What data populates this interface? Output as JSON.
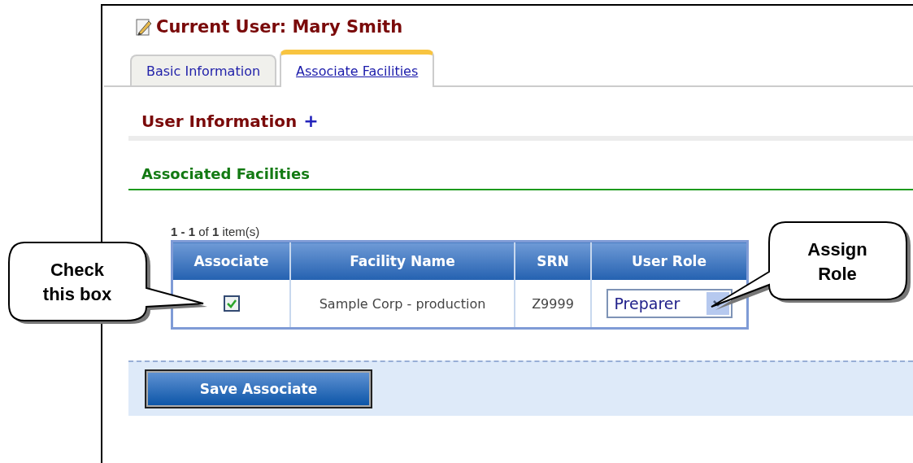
{
  "header": {
    "title": "Current User: Mary Smith"
  },
  "tabs": [
    {
      "label": "Basic Information",
      "selected": false
    },
    {
      "label": "Associate Facilities",
      "selected": true
    }
  ],
  "sections": [
    {
      "kind": "collapsed",
      "title": "User Information",
      "toggle": "+"
    },
    {
      "kind": "open",
      "title": "Associated Facilities"
    }
  ],
  "pager": "**1 - 1** of **1** item(s)",
  "table": {
    "columns": [
      "Associate",
      "Facility Name",
      "SRN",
      "User Role"
    ],
    "rows": [
      {
        "checked": true,
        "facility_name": "Sample Corp - production",
        "srn": "Z9999",
        "user_role": "Preparer"
      }
    ]
  },
  "buttons": [
    "Save Associate"
  ],
  "callouts": [
    {
      "kind": "left",
      "text": "Check this box"
    },
    {
      "kind": "right",
      "text": "Assign Role"
    }
  ]
}
